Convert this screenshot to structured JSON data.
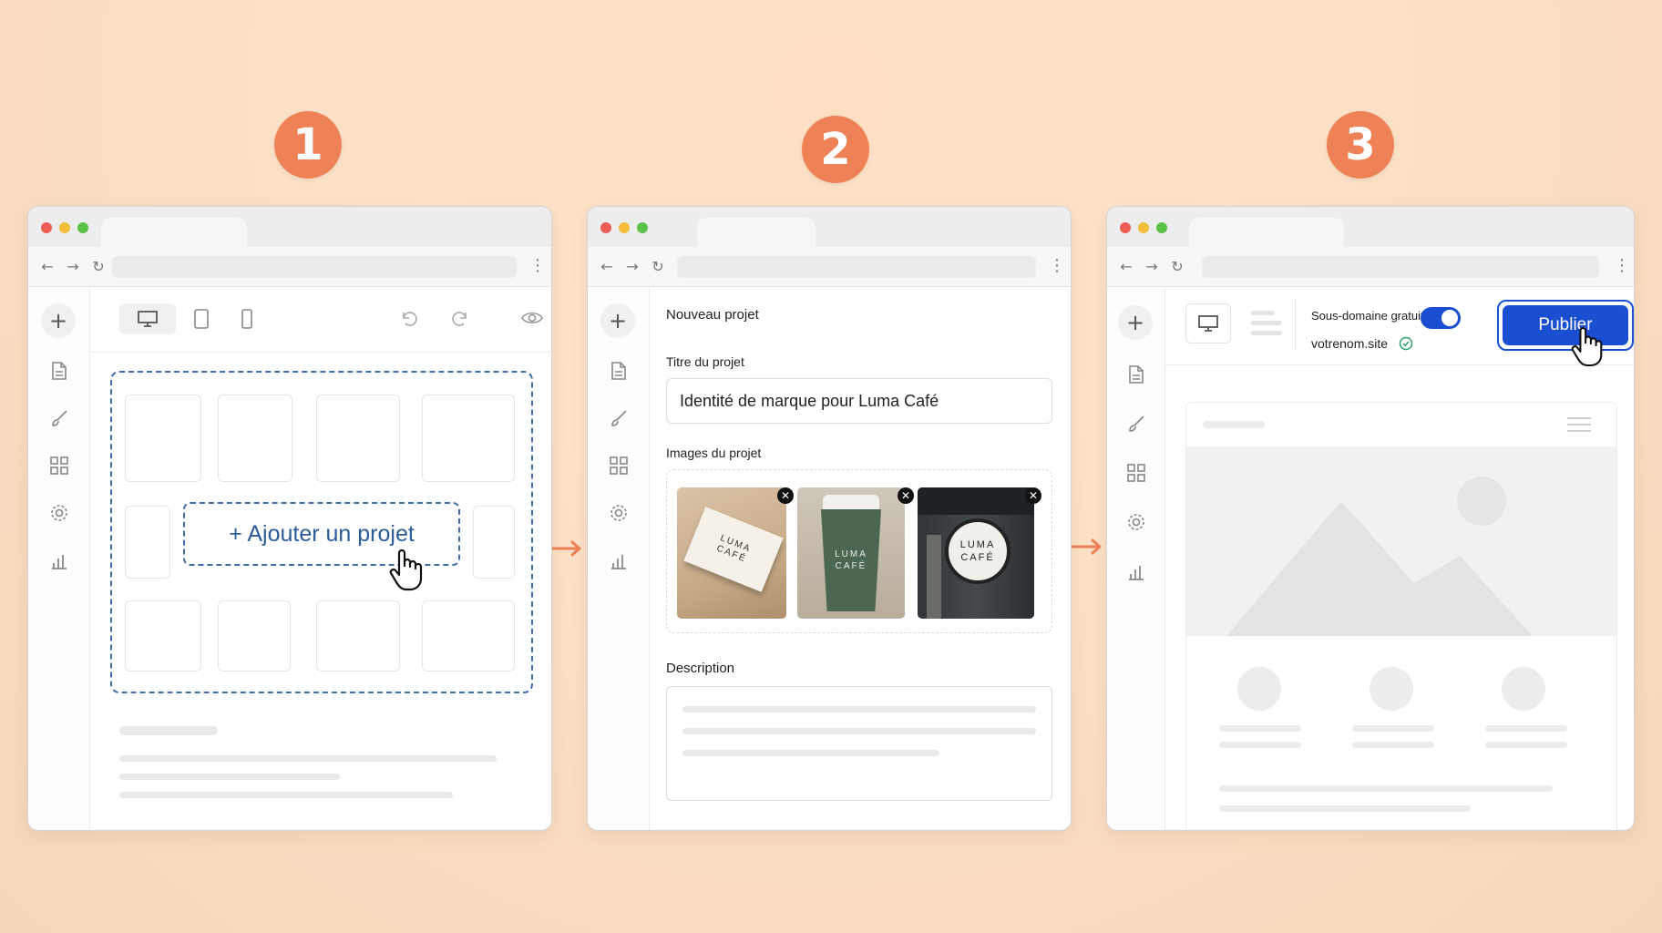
{
  "steps": [
    {
      "number": "1"
    },
    {
      "number": "2"
    },
    {
      "number": "3"
    }
  ],
  "colors": {
    "accent": "#ee8156",
    "primary_button": "#1a4fd1",
    "toggle": "#1a4fd1",
    "dashed_border": "#3e6fa8",
    "success": "#2ea36b",
    "dot_red": "#ec5e55",
    "dot_yellow": "#f4bd3a",
    "dot_green": "#5cc148"
  },
  "step1": {
    "add_project_label": "+ Ajouter un projet",
    "toolbar_icons": [
      "desktop-icon",
      "tablet-icon",
      "mobile-icon",
      "undo-icon",
      "redo-icon",
      "eye-icon"
    ]
  },
  "step2": {
    "form_title": "Nouveau projet",
    "title_label": "Titre du projet",
    "title_value": "Identité de marque pour Luma Café",
    "images_label": "Images du projet",
    "images": [
      {
        "text": "LUMA CAFÉ",
        "kind": "business-card"
      },
      {
        "text": "LUMA CAFÉ",
        "kind": "coffee-cup"
      },
      {
        "text": "LUMA CAFÉ",
        "kind": "storefront-sign"
      }
    ],
    "description_label": "Description"
  },
  "step3": {
    "subdomain_label": "Sous-domaine gratuit",
    "subdomain_value": "votrenom.site",
    "toggle_on": true,
    "publish_label": "Publier"
  },
  "sidebar_icons": [
    "add-icon",
    "page-icon",
    "brush-icon",
    "grid-icon",
    "settings-icon",
    "analytics-icon"
  ]
}
